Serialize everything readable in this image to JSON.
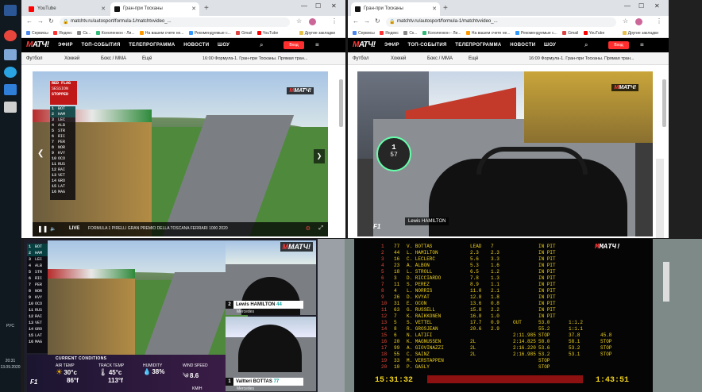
{
  "taskbar": {
    "time": "20:31",
    "date": "13.09.2020",
    "lang": "РУС"
  },
  "left_window": {
    "tabs": [
      {
        "label": "YouTube"
      },
      {
        "label": "Гран-при Тосканы"
      }
    ],
    "url": "matchtv.ru/autosport/formula-1/matchtvvideo_...",
    "bookmarks": [
      "Сервисы",
      "Яндекс",
      "Ск...",
      "Ксеоленкон - Ли...",
      "На вашем счете не...",
      "Рекомендуемые с...",
      "Gmail",
      "YouTube",
      "Другие закладки"
    ],
    "nav": [
      "ЭФИР",
      "ТОП-СОБЫТИЯ",
      "ТЕЛЕПРОГРАММА",
      "НОВОСТИ",
      "ШОУ"
    ],
    "login": "Вход",
    "subnav": [
      "Футбол",
      "Хоккей",
      "Бокс / ММА",
      "Ещё"
    ],
    "stream_title": "16:00 Формула-1. Гран-при Тосканы. Прямая тран...",
    "live_label": "LIVE",
    "ticker": "FORMULA 1 PIRELLI GRAN PREMIO DELLA TOSCANA FERRARI 1000 2020",
    "red_flag": [
      "RED FLAG",
      "SESSION",
      "STOPPED"
    ]
  },
  "right_window": {
    "tabs": [
      {
        "label": "Гран-при Тосканы"
      }
    ],
    "url": "matchtv.ru/autosport/formula-1/matchtvvideo_...",
    "bookmarks": [
      "Сервисы",
      "Яндекс",
      "Ск...",
      "Ксеоленкон - Ли...",
      "На вашем счете не...",
      "Рекомендуемые с...",
      "Gmail",
      "YouTube",
      "Другие закладки"
    ],
    "nav": [
      "ЭФИР",
      "ТОП-СОБЫТИЯ",
      "ТЕЛЕПРОГРАММА",
      "НОВОСТИ",
      "ШОУ"
    ],
    "login": "Вход",
    "subnav": [
      "Футбол",
      "Хоккей",
      "Бокс / ММА",
      "Ещё"
    ],
    "stream_title": "16:00 Формула-1. Гран-при Тосканы. Прямая тран...",
    "onboard_driver": "Lewis HAMILTON",
    "speed": "57",
    "gear": "1"
  },
  "watermark": "МАТЧ!",
  "leaderboard_left": [
    {
      "p": "1",
      "d": "BOT"
    },
    {
      "p": "2",
      "d": "HAM"
    },
    {
      "p": "3",
      "d": "LEC"
    },
    {
      "p": "4",
      "d": "ALB"
    },
    {
      "p": "5",
      "d": "STR"
    },
    {
      "p": "6",
      "d": "RIC"
    },
    {
      "p": "7",
      "d": "PER"
    },
    {
      "p": "8",
      "d": "NOR"
    },
    {
      "p": "9",
      "d": "KVY"
    },
    {
      "p": "10",
      "d": "OCO"
    },
    {
      "p": "11",
      "d": "RUS"
    },
    {
      "p": "12",
      "d": "RAI"
    },
    {
      "p": "13",
      "d": "VET"
    },
    {
      "p": "14",
      "d": "GRO"
    },
    {
      "p": "15",
      "d": "LAT"
    },
    {
      "p": "16",
      "d": "MAG"
    }
  ],
  "leaderboard_bottom": [
    {
      "p": "1",
      "d": "BOT"
    },
    {
      "p": "2",
      "d": "HAM"
    },
    {
      "p": "3",
      "d": "LEC"
    },
    {
      "p": "4",
      "d": "ALB"
    },
    {
      "p": "5",
      "d": "STR"
    },
    {
      "p": "6",
      "d": "RIC"
    },
    {
      "p": "7",
      "d": "PER"
    },
    {
      "p": "8",
      "d": "NOR"
    },
    {
      "p": "9",
      "d": "KVY"
    },
    {
      "p": "10",
      "d": "OCO"
    },
    {
      "p": "11",
      "d": "RUS"
    },
    {
      "p": "12",
      "d": "RAI"
    },
    {
      "p": "13",
      "d": "VET"
    },
    {
      "p": "14",
      "d": "GRO"
    },
    {
      "p": "15",
      "d": "LAT"
    },
    {
      "p": "16",
      "d": "MAG"
    }
  ],
  "onboard_cams": [
    {
      "pos": "2",
      "name": "Lewis HAMILTON",
      "num": "44",
      "team": "Mercedes"
    },
    {
      "pos": "1",
      "name": "Valtteri BOTTAS",
      "num": "77",
      "team": "Mercedes"
    }
  ],
  "conditions": {
    "header": "CURRENT CONDITIONS",
    "air_temp_label": "AIR TEMP",
    "air_c": "30°c",
    "air_f": "86°f",
    "track_temp_label": "TRACK TEMP",
    "track_c": "45°c",
    "track_f": "113°f",
    "humidity_label": "HUMIDITY",
    "humidity": "38%",
    "wind_label": "WIND SPEED",
    "wind": "8.6",
    "wind_unit": "KM/H"
  },
  "timing": {
    "rows": [
      {
        "pos": "1",
        "no": "77",
        "name": "V.  BOTTAS",
        "gap": "LEAD",
        "int": "7",
        "s1": "",
        "status": "IN PIT"
      },
      {
        "pos": "2",
        "no": "44",
        "name": "L.  HAMILTON",
        "gap": "2.3",
        "int": "2.3",
        "s1": "",
        "status": "IN PIT"
      },
      {
        "pos": "3",
        "no": "16",
        "name": "C.  LECLERC",
        "gap": "5.6",
        "int": "3.3",
        "s1": "",
        "status": "IN PIT"
      },
      {
        "pos": "4",
        "no": "23",
        "name": "A.  ALBON",
        "gap": "5.3",
        "int": "1.6",
        "s1": "",
        "status": "IN PIT"
      },
      {
        "pos": "5",
        "no": "18",
        "name": "L.  STROLL",
        "gap": "6.5",
        "int": "1.2",
        "s1": "",
        "status": "IN PIT"
      },
      {
        "pos": "6",
        "no": "3",
        "name": "D.  RICCIARDO",
        "gap": "7.8",
        "int": "1.3",
        "s1": "",
        "status": "IN PIT"
      },
      {
        "pos": "7",
        "no": "11",
        "name": "S.  PEREZ",
        "gap": "8.9",
        "int": "1.1",
        "s1": "",
        "status": "IN PIT"
      },
      {
        "pos": "8",
        "no": "4",
        "name": "L.  NORRIS",
        "gap": "11.0",
        "int": "2.1",
        "s1": "",
        "status": "IN PIT"
      },
      {
        "pos": "9",
        "no": "26",
        "name": "D.  KVYAT",
        "gap": "12.8",
        "int": "1.8",
        "s1": "",
        "status": "IN PIT"
      },
      {
        "pos": "10",
        "no": "31",
        "name": "E.  OCON",
        "gap": "13.6",
        "int": "0.8",
        "s1": "",
        "status": "IN PIT"
      },
      {
        "pos": "11",
        "no": "63",
        "name": "G.  RUSSELL",
        "gap": "15.8",
        "int": "2.2",
        "s1": "",
        "status": "IN PIT"
      },
      {
        "pos": "12",
        "no": "7",
        "name": "K.  RAIKKONEN",
        "gap": "16.8",
        "int": "1.0",
        "s1": "",
        "status": "IN PIT"
      },
      {
        "pos": "13",
        "no": "5",
        "name": "S.  VETTEL",
        "gap": "17.7",
        "int": "0.9",
        "s1": "OUT",
        "status": "53.0"
      },
      {
        "pos": "14",
        "no": "8",
        "name": "R.  GROSJEAN",
        "gap": "20.6",
        "int": "2.9",
        "s1": "",
        "status": "55.2"
      },
      {
        "pos": "15",
        "no": "6",
        "name": "N.  LATIFI",
        "gap": "",
        "int": "",
        "s1": "2:11.985",
        "status": "STOP"
      },
      {
        "pos": "16",
        "no": "20",
        "name": "K.  MAGNUSSEN",
        "gap": "2L",
        "int": "",
        "s1": "2:14.825",
        "status": "58.0"
      },
      {
        "pos": "17",
        "no": "99",
        "name": "A.  GIOVINAZZI",
        "gap": "2L",
        "int": "",
        "s1": "2:16.220",
        "status": "53.6"
      },
      {
        "pos": "18",
        "no": "55",
        "name": "C.  SAINZ",
        "gap": "2L",
        "int": "",
        "s1": "2:16.985",
        "status": "53.2"
      },
      {
        "pos": "19",
        "no": "33",
        "name": "M.  VERSTAPPEN",
        "gap": "",
        "int": "",
        "s1": "",
        "status": "STOP"
      },
      {
        "pos": "20",
        "no": "10",
        "name": "P.  GASLY",
        "gap": "",
        "int": "",
        "s1": "",
        "status": "STOP"
      }
    ],
    "extra_cols": [
      {
        "a": "",
        "b": ""
      },
      {
        "a": "",
        "b": ""
      },
      {
        "a": "",
        "b": ""
      },
      {
        "a": "",
        "b": ""
      },
      {
        "a": "",
        "b": ""
      },
      {
        "a": "",
        "b": ""
      },
      {
        "a": "",
        "b": ""
      },
      {
        "a": "",
        "b": ""
      },
      {
        "a": "",
        "b": ""
      },
      {
        "a": "",
        "b": ""
      },
      {
        "a": "",
        "b": ""
      },
      {
        "a": "",
        "b": ""
      },
      {
        "a": "1:1.2",
        "b": ""
      },
      {
        "a": "1:1.1",
        "b": ""
      },
      {
        "a": "37.8",
        "b": "45.8"
      },
      {
        "a": "58.1",
        "b": "STOP"
      },
      {
        "a": "53.2",
        "b": "STOP"
      },
      {
        "a": "53.1",
        "b": "STOP"
      },
      {
        "a": "",
        "b": ""
      },
      {
        "a": "",
        "b": ""
      }
    ],
    "clock_left": "15:31:32",
    "clock_right": "1:43:51"
  },
  "colors": {
    "accent_red": "#ff2e2e",
    "timing_yellow": "#f1d31a",
    "position_red": "#e84b3c"
  }
}
